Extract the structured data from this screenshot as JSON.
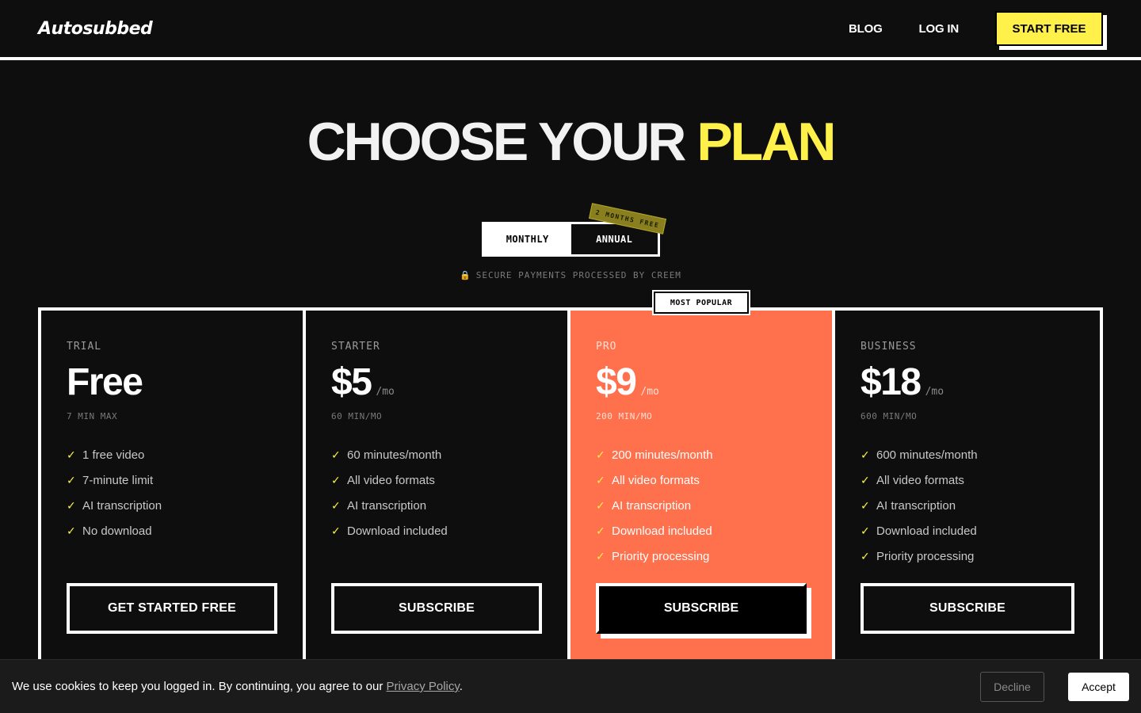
{
  "header": {
    "logo": "Autosubbed",
    "nav": [
      "BLOG",
      "LOG IN"
    ],
    "cta": "START FREE"
  },
  "hero": {
    "title_main": "CHOOSE YOUR ",
    "title_accent": "PLAN"
  },
  "billing_toggle": {
    "monthly": "MONTHLY",
    "annual": "ANNUAL",
    "badge": "2 MONTHS FREE",
    "selected": "ANNUAL"
  },
  "secure_note": {
    "icon": "lock-icon",
    "text": "SECURE PAYMENTS PROCESSED BY CREEM"
  },
  "plans": [
    {
      "tier": "TRIAL",
      "price": "Free",
      "per": "",
      "minutes": "7 MIN MAX",
      "features": [
        "1 free video",
        "7-minute limit",
        "AI transcription",
        "No download"
      ],
      "cta": "GET STARTED FREE"
    },
    {
      "tier": "STARTER",
      "price": "$5",
      "per": "/mo",
      "minutes": "60 MIN/MO",
      "features": [
        "60 minutes/month",
        "All video formats",
        "AI transcription",
        "Download included"
      ],
      "cta": "SUBSCRIBE"
    },
    {
      "tier": "PRO",
      "price": "$9",
      "per": "/mo",
      "minutes": "200 MIN/MO",
      "badge": "MOST POPULAR",
      "features": [
        "200 minutes/month",
        "All video formats",
        "AI transcription",
        "Download included",
        "Priority processing"
      ],
      "cta": "SUBSCRIBE"
    },
    {
      "tier": "BUSINESS",
      "price": "$18",
      "per": "/mo",
      "minutes": "600 MIN/MO",
      "features": [
        "600 minutes/month",
        "All video formats",
        "AI transcription",
        "Download included",
        "Priority processing"
      ],
      "cta": "SUBSCRIBE"
    }
  ],
  "cookie": {
    "text": "We use cookies to keep you logged in. By continuing, you agree to our ",
    "link": "Privacy Policy",
    "suffix": ".",
    "decline": "Decline",
    "accept": "Accept"
  },
  "colors": {
    "background": "#0e0e0e",
    "accent_yellow": "#fff04a",
    "pro_orange": "#ff714d"
  }
}
